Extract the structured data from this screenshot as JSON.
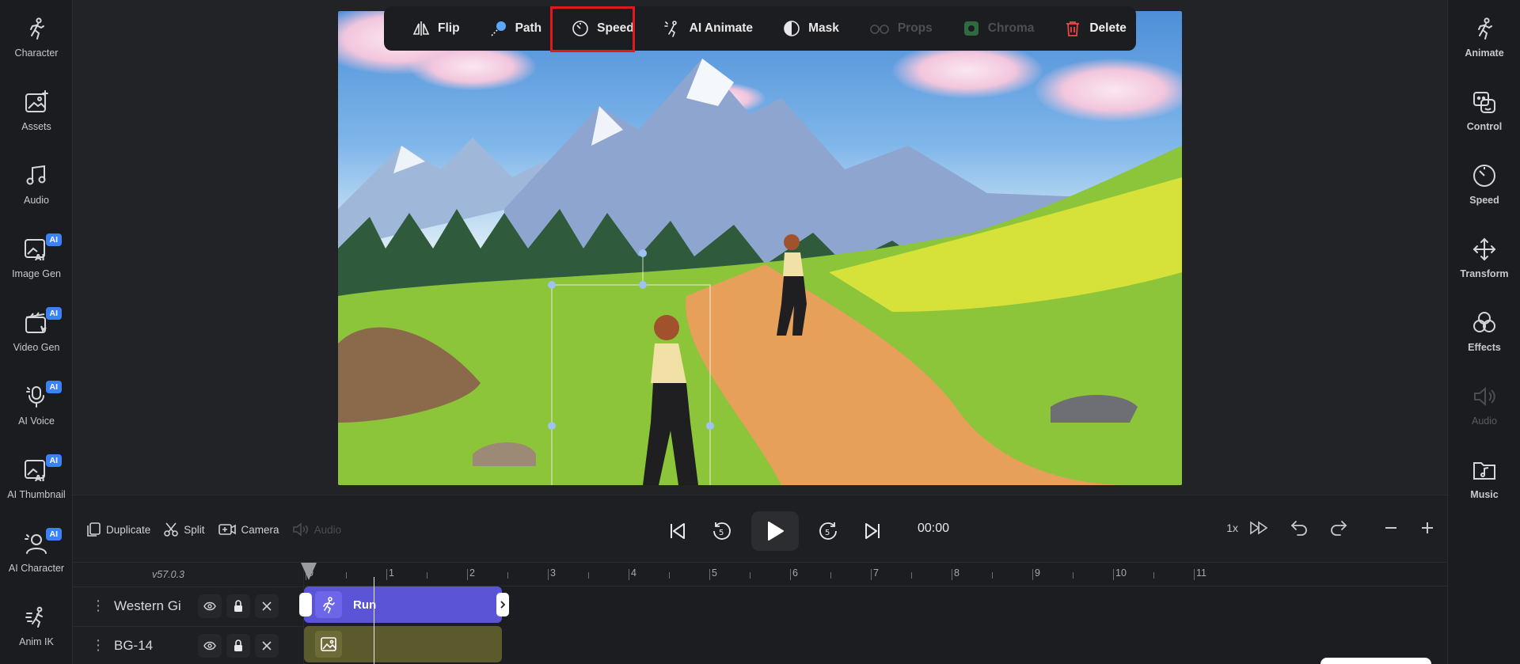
{
  "left_sidebar": {
    "items": [
      {
        "label": "Character",
        "icon": "character-icon",
        "ai": ""
      },
      {
        "label": "Assets",
        "icon": "assets-icon",
        "ai": ""
      },
      {
        "label": "Audio",
        "icon": "music-note-icon",
        "ai": ""
      },
      {
        "label": "Image Gen",
        "icon": "image-gen-icon",
        "ai": "AI"
      },
      {
        "label": "Video Gen",
        "icon": "video-gen-icon",
        "ai": "AI"
      },
      {
        "label": "AI Voice",
        "icon": "microphone-icon",
        "ai": "AI"
      },
      {
        "label": "AI Thumbnail",
        "icon": "thumbnail-icon",
        "ai": "AI"
      },
      {
        "label": "AI Character",
        "icon": "ai-character-icon",
        "ai": "AI"
      },
      {
        "label": "Anim IK",
        "icon": "anim-ik-icon",
        "ai": ""
      }
    ]
  },
  "right_sidebar": {
    "items": [
      {
        "label": "Animate",
        "icon": "animate-icon",
        "disabled": false
      },
      {
        "label": "Control",
        "icon": "control-icon",
        "disabled": false
      },
      {
        "label": "Speed",
        "icon": "speed-icon",
        "disabled": false
      },
      {
        "label": "Transform",
        "icon": "transform-icon",
        "disabled": false
      },
      {
        "label": "Effects",
        "icon": "effects-icon",
        "disabled": false
      },
      {
        "label": "Audio",
        "icon": "audio-icon",
        "disabled": true
      },
      {
        "label": "Music",
        "icon": "music-icon",
        "disabled": false
      }
    ]
  },
  "toolbar": {
    "flip": "Flip",
    "path": "Path",
    "speed": "Speed",
    "ai_animate": "AI Animate",
    "mask": "Mask",
    "props": "Props",
    "chroma": "Chroma",
    "delete": "Delete"
  },
  "controls": {
    "duplicate": "Duplicate",
    "split": "Split",
    "camera": "Camera",
    "audio": "Audio",
    "time": "00:00",
    "speed": "1x"
  },
  "timeline": {
    "version": "v57.0.3",
    "ticks": [
      "0",
      "1",
      "2",
      "3",
      "4",
      "5",
      "6",
      "7",
      "8",
      "9",
      "10",
      "11"
    ],
    "tracks": [
      {
        "name": "Western Gi"
      },
      {
        "name": "BG-14"
      }
    ],
    "clip_run": "Run"
  },
  "colors": {
    "accent": "#5b54d6",
    "highlight": "#e01a1a",
    "ai_badge": "#3b82f6"
  }
}
